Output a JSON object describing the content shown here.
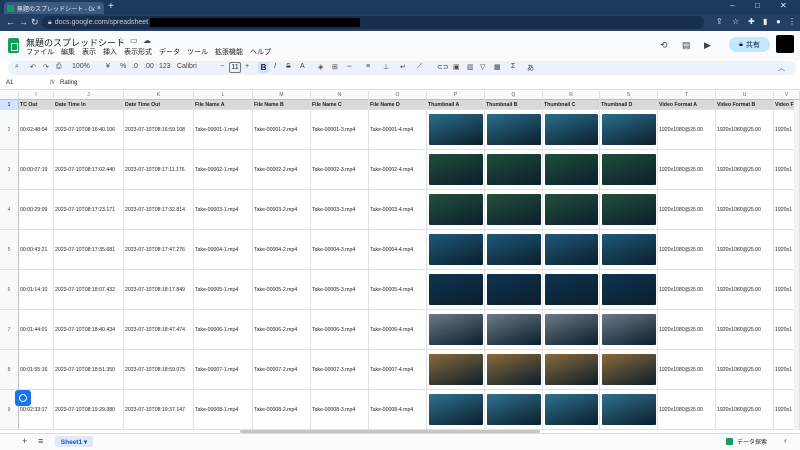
{
  "browser": {
    "tab_title": "無題のスプレッドシート - Google スプ",
    "tab_close": "×",
    "new_tab": "+",
    "url_prefix": "docs.google.com/spreadsheet",
    "win_min": "–",
    "win_max": "□",
    "win_close": "✕"
  },
  "app": {
    "title": "無題のスプレッドシート",
    "menus": [
      "ファイル",
      "編集",
      "表示",
      "挿入",
      "表示形式",
      "データ",
      "ツール",
      "拡張機能",
      "ヘルプ"
    ],
    "share_label": "共有"
  },
  "toolbar": {
    "zoom": "100%",
    "font": "Calibri",
    "font_size": "11",
    "percent": "%",
    "currency": "¥",
    "decimal_dec": ".0",
    "decimal_inc": ".00",
    "num123": "123",
    "bold": "B"
  },
  "formula": {
    "namebox": "A1",
    "fx": "fx",
    "value": "Rating"
  },
  "columns": [
    "I",
    "J",
    "K",
    "L",
    "M",
    "N",
    "O",
    "P",
    "Q",
    "R",
    "S",
    "T",
    "U",
    "V"
  ],
  "header_row": [
    "TC Out",
    "Date Time In",
    "Date Time Out",
    "File Name A",
    "File Name B",
    "File Name C",
    "File Name D",
    "Thumbnail A",
    "Thumbnail B",
    "Thumbnail C",
    "Thumbnail D",
    "Video Format A",
    "Video Format B",
    "Video F"
  ],
  "rows": [
    {
      "n": "2",
      "tc": "00:02:48:04",
      "in": "2023-07-10T08:16:40.106",
      "out": "2023-07-10T08:16:59.108",
      "a": "Take-00001-1.mp4",
      "b": "Take-00001-2.mp4",
      "c": "Take-00001-3.mp4",
      "d": "Take-00001-4.mp4",
      "fa": "1920x1080@25.00",
      "fb": "1920x1080@25.00",
      "fc": "1920x1"
    },
    {
      "n": "3",
      "tc": "00:00:07:19",
      "in": "2023-07-10T08:17:02.440",
      "out": "2023-07-10T08:17:11.176",
      "a": "Take-00002-1.mp4",
      "b": "Take-00002-2.mp4",
      "c": "Take-00002-3.mp4",
      "d": "Take-00002-4.mp4",
      "fa": "1920x1080@25.00",
      "fb": "1920x1080@25.00",
      "fc": "1920x1"
    },
    {
      "n": "4",
      "tc": "00:00:29:09",
      "in": "2023-07-10T08:17:23.171",
      "out": "2023-07-10T08:17:32.814",
      "a": "Take-00003-1.mp4",
      "b": "Take-00003-2.mp4",
      "c": "Take-00003-3.mp4",
      "d": "Take-00003-4.mp4",
      "fa": "1920x1080@25.00",
      "fb": "1920x1080@25.00",
      "fc": "1920x1"
    },
    {
      "n": "5",
      "tc": "00:00:43:21",
      "in": "2023-07-10T08:17:35.681",
      "out": "2023-07-10T08:17:47.276",
      "a": "Take-00004-1.mp4",
      "b": "Take-00004-2.mp4",
      "c": "Take-00004-3.mp4",
      "d": "Take-00004-4.mp4",
      "fa": "1920x1080@25.00",
      "fb": "1920x1080@25.00",
      "fc": "1920x1"
    },
    {
      "n": "6",
      "tc": "00:01:14:10",
      "in": "2023-07-10T08:18:07.432",
      "out": "2023-07-10T08:18:17.849",
      "a": "Take-00005-1.mp4",
      "b": "Take-00005-2.mp4",
      "c": "Take-00005-3.mp4",
      "d": "Take-00005-4.mp4",
      "fa": "1920x1080@25.00",
      "fb": "1920x1080@25.00",
      "fc": "1920x1"
    },
    {
      "n": "7",
      "tc": "00:01:44:01",
      "in": "2023-07-10T08:18:40.434",
      "out": "2023-07-10T08:18:47.474",
      "a": "Take-00006-1.mp4",
      "b": "Take-00006-2.mp4",
      "c": "Take-00006-3.mp4",
      "d": "Take-00006-4.mp4",
      "fa": "1920x1080@25.00",
      "fb": "1920x1080@25.00",
      "fc": "1920x1"
    },
    {
      "n": "8",
      "tc": "00:01:55:16",
      "in": "2023-07-10T08:18:51.350",
      "out": "2023-07-10T08:18:59.075",
      "a": "Take-00007-1.mp4",
      "b": "Take-00007-2.mp4",
      "c": "Take-00007-3.mp4",
      "d": "Take-00007-4.mp4",
      "fa": "1920x1080@25.00",
      "fb": "1920x1080@25.00",
      "fc": "1920x1"
    },
    {
      "n": "9",
      "tc": "00:02:33:17",
      "in": "2023-07-10T08:19:29.380",
      "out": "2023-07-10T08:19:37.147",
      "a": "Take-00008-1.mp4",
      "b": "Take-00008-2.mp4",
      "c": "Take-00008-3.mp4",
      "d": "Take-00008-4.mp4",
      "fa": "1920x1080@25.00",
      "fb": "1920x1080@25.00",
      "fc": "1920x1"
    }
  ],
  "row1_label": "1",
  "sheet": {
    "add": "+",
    "list": "≡",
    "tab": "Sheet1 ▾"
  },
  "explore_label": "データ探索",
  "thumb_colors": [
    "#2a6f8a",
    "#1f4f3a",
    "#24503c",
    "#1e5a7a",
    "#0e3550",
    "#6a7a88",
    "#8a6a3a",
    "#2f7290"
  ]
}
